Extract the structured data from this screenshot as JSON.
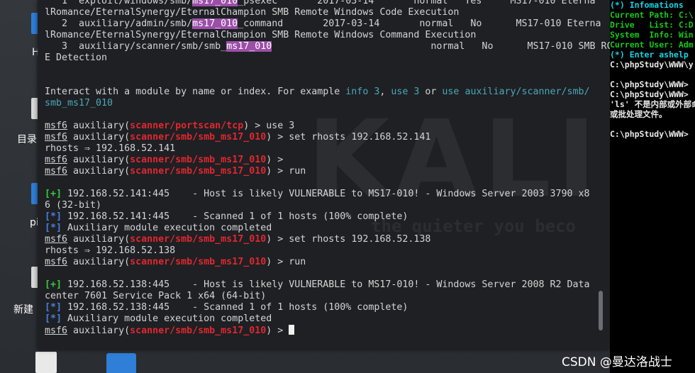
{
  "desktop": {
    "icon_labels": [
      "H",
      "目录",
      "pi",
      "新建"
    ]
  },
  "terminal": {
    "watermark": "KALI",
    "watermark_sub": "the quieter you beco",
    "lines": [
      [
        {
          "t": "   1  exploit/windows/smb/"
        },
        {
          "t": "ms17_010",
          "c": "hl"
        },
        {
          "t": "_psexec       2017-03-14       normal   Yes     MS17-010 Eterna"
        }
      ],
      [
        {
          "t": "lRomance/EternalSynergy/EternalChampion SMB Remote Windows Code Execution"
        }
      ],
      [
        {
          "t": "   2  auxiliary/admin/smb/"
        },
        {
          "t": "ms17_010",
          "c": "hl"
        },
        {
          "t": "_command       2017-03-14       normal   No      MS17-010 Eterna"
        }
      ],
      [
        {
          "t": "lRomance/EternalSynergy/EternalChampion SMB Remote Windows Command Execution"
        }
      ],
      [
        {
          "t": "   3  auxiliary/scanner/smb/smb_"
        },
        {
          "t": "ms17_010",
          "c": "hl"
        },
        {
          "t": "                            normal   No      MS17-010 SMB RC"
        }
      ],
      [
        {
          "t": "E Detection"
        }
      ],
      [
        {
          "t": ""
        }
      ],
      [
        {
          "t": ""
        }
      ],
      [
        {
          "t": "Interact with a module by name or index. For example "
        },
        {
          "t": "info 3",
          "c": "cyan"
        },
        {
          "t": ", "
        },
        {
          "t": "use 3",
          "c": "cyan"
        },
        {
          "t": " or "
        },
        {
          "t": "use auxiliary/scanner/smb/",
          "c": "cyan"
        }
      ],
      [
        {
          "t": "smb_ms17_010",
          "c": "cyan"
        }
      ],
      [
        {
          "t": ""
        }
      ],
      [
        {
          "t": "msf6",
          "c": "prompt"
        },
        {
          "t": " auxiliary("
        },
        {
          "t": "scanner/portscan/tcp",
          "c": "mod"
        },
        {
          "t": ") > use 3"
        }
      ],
      [
        {
          "t": "msf6",
          "c": "prompt"
        },
        {
          "t": " auxiliary("
        },
        {
          "t": "scanner/smb/smb_ms17_010",
          "c": "mod"
        },
        {
          "t": ") > set rhosts 192.168.52.141"
        }
      ],
      [
        {
          "t": "rhosts ⇒ 192.168.52.141"
        }
      ],
      [
        {
          "t": "msf6",
          "c": "prompt"
        },
        {
          "t": " auxiliary("
        },
        {
          "t": "scanner/smb/smb_ms17_010",
          "c": "mod"
        },
        {
          "t": ") >"
        }
      ],
      [
        {
          "t": "msf6",
          "c": "prompt"
        },
        {
          "t": " auxiliary("
        },
        {
          "t": "scanner/smb/smb_ms17_010",
          "c": "mod"
        },
        {
          "t": ") > run"
        }
      ],
      [
        {
          "t": ""
        }
      ],
      [
        {
          "t": "[+]",
          "c": "green"
        },
        {
          "t": " 192.168.52.141:445    - Host is likely VULNERABLE to MS17-010! - Windows Server 2003 3790 x8"
        }
      ],
      [
        {
          "t": "6 (32-bit)"
        }
      ],
      [
        {
          "t": "[*]",
          "c": "blue"
        },
        {
          "t": " 192.168.52.141:445    - Scanned 1 of 1 hosts (100% complete)"
        }
      ],
      [
        {
          "t": "[*]",
          "c": "blue"
        },
        {
          "t": " Auxiliary module execution completed"
        }
      ],
      [
        {
          "t": "msf6",
          "c": "prompt"
        },
        {
          "t": " auxiliary("
        },
        {
          "t": "scanner/smb/smb_ms17_010",
          "c": "mod"
        },
        {
          "t": ") > set rhosts 192.168.52.138"
        }
      ],
      [
        {
          "t": "rhosts ⇒ 192.168.52.138"
        }
      ],
      [
        {
          "t": "msf6",
          "c": "prompt"
        },
        {
          "t": " auxiliary("
        },
        {
          "t": "scanner/smb/smb_ms17_010",
          "c": "mod"
        },
        {
          "t": ") > run"
        }
      ],
      [
        {
          "t": ""
        }
      ],
      [
        {
          "t": "[+]",
          "c": "green"
        },
        {
          "t": " 192.168.52.138:445    - Host is likely VULNERABLE to MS17-010! - Windows Server 2008 R2 Data"
        }
      ],
      [
        {
          "t": "center 7601 Service Pack 1 x64 (64-bit)"
        }
      ],
      [
        {
          "t": "[*]",
          "c": "blue"
        },
        {
          "t": " 192.168.52.138:445    - Scanned 1 of 1 hosts (100% complete)"
        }
      ],
      [
        {
          "t": "[*]",
          "c": "blue"
        },
        {
          "t": " Auxiliary module execution completed"
        }
      ],
      [
        {
          "t": "msf6",
          "c": "prompt"
        },
        {
          "t": " auxiliary("
        },
        {
          "t": "scanner/smb/smb_ms17_010",
          "c": "mod"
        },
        {
          "t": ") > "
        },
        {
          "t": "",
          "c": "cursor"
        }
      ]
    ]
  },
  "side_console": {
    "lines": [
      {
        "t": "(*) Infomations",
        "c": "r-cyan"
      },
      {
        "t": "Current Path: C:\\",
        "c": "r-green"
      },
      {
        "t": "Drive   List: C:D",
        "c": "r-green"
      },
      {
        "t": "System  Info: Win",
        "c": "r-green"
      },
      {
        "t": "Current User: Adm",
        "c": "r-green"
      },
      {
        "t": "(*) Enter ashelp",
        "c": "r-cyan"
      },
      {
        "t": "C:\\phpStudy\\WWW\\y",
        "c": ""
      },
      {
        "t": "",
        "c": ""
      },
      {
        "t": "C:\\phpStudy\\WWW>",
        "c": ""
      },
      {
        "t": "C:\\phpStudy\\WWW>",
        "c": ""
      },
      {
        "t": "'ls' 不是内部或外部命",
        "c": ""
      },
      {
        "t": "或批处理文件。",
        "c": ""
      },
      {
        "t": "",
        "c": ""
      },
      {
        "t": "C:\\phpStudy\\WWW>",
        "c": ""
      }
    ]
  },
  "watermark_text": "CSDN @曼达洛战士"
}
